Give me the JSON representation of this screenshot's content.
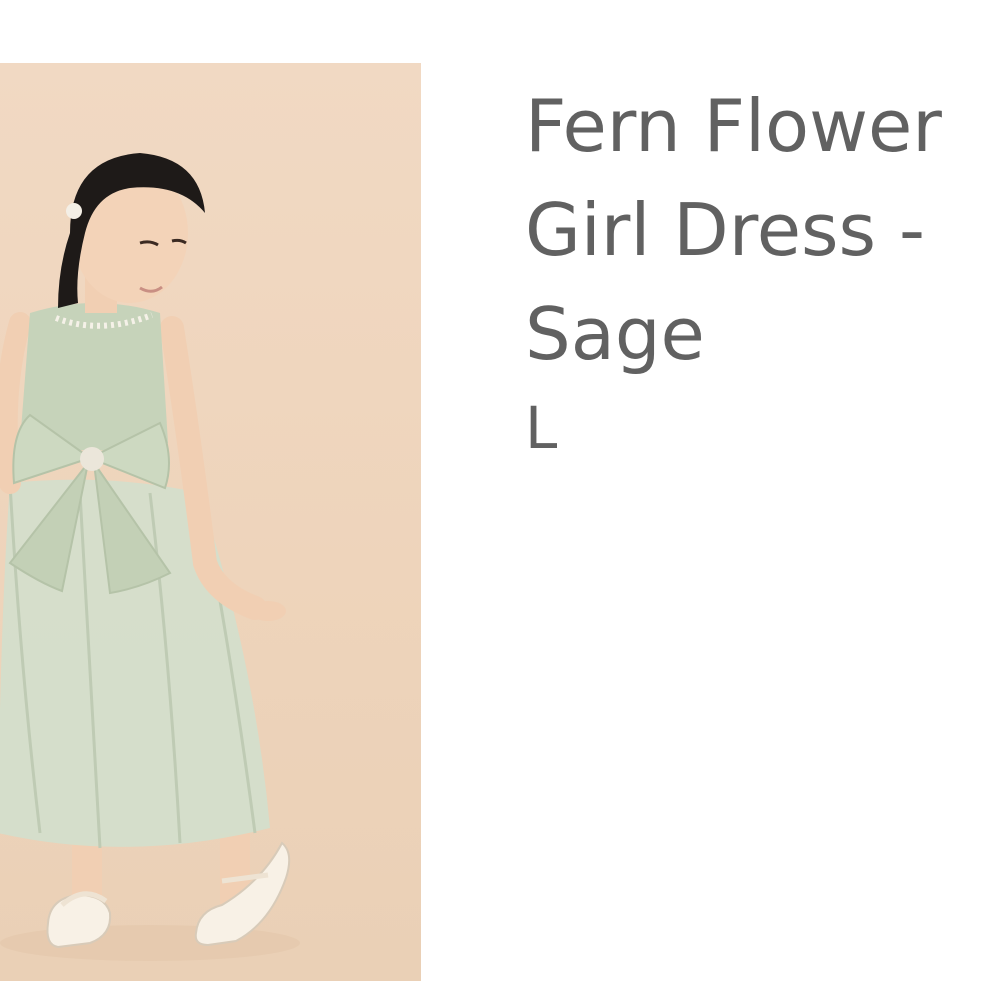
{
  "product": {
    "title": "Fern Flower\nGirl Dress -\nSage",
    "size": "L"
  },
  "image": {
    "subject": "girl-in-sage-flower-girl-dress",
    "background_color": "#efd6be",
    "dress_color": "#c9d6bd"
  }
}
